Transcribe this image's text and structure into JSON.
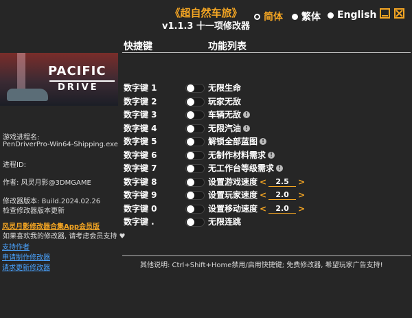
{
  "header": {
    "title": "《超自然车旅》",
    "version": "v1.1.3 十一项修改器"
  },
  "languages": [
    {
      "label": "简体",
      "selected": true,
      "color": "#f5a623"
    },
    {
      "label": "繁体",
      "selected": false,
      "color": "#ffffff"
    },
    {
      "label": "English",
      "selected": false,
      "color": "#ffffff"
    }
  ],
  "window_buttons": {
    "minimize": "minimize-icon",
    "close": "close-icon"
  },
  "columns": {
    "hotkey": "快捷键",
    "function": "功能列表"
  },
  "banner": {
    "line1": "PACIFIC",
    "line2": "DRIVE"
  },
  "sidebar": {
    "process_label": "游戏进程名:",
    "process_name": "PenDriverPro-Win64-Shipping.exe",
    "pid_label": "进程ID:",
    "author": "作者: 风灵月影@3DMGAME",
    "trainer_version": "修改器版本: Build.2024.02.26",
    "check_update": "检查修改器版本更新",
    "app_link": "风灵月影修改器合集App会员版",
    "support_text": "如果喜欢我的修改器, 请考虑会员支持",
    "link_support": "支持作者",
    "link_request": "申请制作修改器",
    "link_update": "请求更新修改器"
  },
  "cheats": [
    {
      "key": "数字键 1",
      "label": "无限生命",
      "warn": false
    },
    {
      "key": "数字键 2",
      "label": "玩家无敌",
      "warn": false
    },
    {
      "key": "数字键 3",
      "label": "车辆无敌",
      "warn": true
    },
    {
      "key": "数字键 4",
      "label": "无限汽油",
      "warn": true
    },
    {
      "key": "数字键 5",
      "label": "解锁全部蓝图",
      "warn": true
    },
    {
      "key": "数字键 6",
      "label": "无制作材料需求",
      "warn": true
    },
    {
      "key": "数字键 7",
      "label": "无工作台等级需求",
      "warn": true
    },
    {
      "key": "数字键 8",
      "label": "设置游戏速度",
      "warn": false,
      "value": "2.5"
    },
    {
      "key": "数字键 9",
      "label": "设置玩家速度",
      "warn": false,
      "value": "2.0"
    },
    {
      "key": "数字键 0",
      "label": "设置移动速度",
      "warn": false,
      "value": "2.0"
    },
    {
      "key": "数字键 .",
      "label": "无限连跳",
      "warn": false
    }
  ],
  "warn_glyph": "!",
  "arrows": {
    "left": "<",
    "right": ">"
  },
  "footer_note": "其他说明: Ctrl+Shift+Home禁用/启用快捷键; 免费修改器, 希望玩家广告支持!",
  "accent_color": "#f5a623",
  "background_color": "#262626"
}
